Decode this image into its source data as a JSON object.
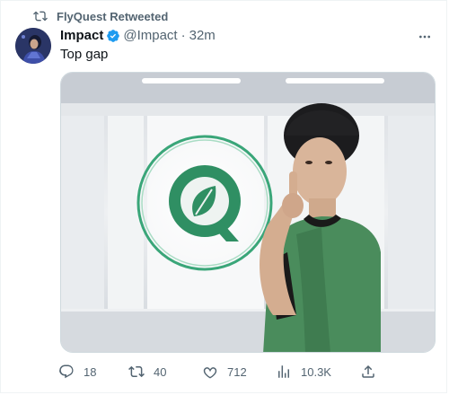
{
  "retweet": {
    "text": "FlyQuest Retweeted",
    "icon": "retweet-icon"
  },
  "author": {
    "name": "Impact",
    "handle": "@Impact",
    "separator": "·",
    "time": "32m",
    "verified_icon": "verified-badge-icon"
  },
  "tweet": {
    "text": "Top gap"
  },
  "actions": {
    "reply_count": "18",
    "retweet_count": "40",
    "like_count": "712",
    "views_count": "10.3K"
  },
  "colors": {
    "text_primary": "#0f1419",
    "text_secondary": "#536471",
    "verified_blue": "#1d9bf0",
    "logo_green": "#2f8f63",
    "jersey_green": "#4a8c5c"
  }
}
